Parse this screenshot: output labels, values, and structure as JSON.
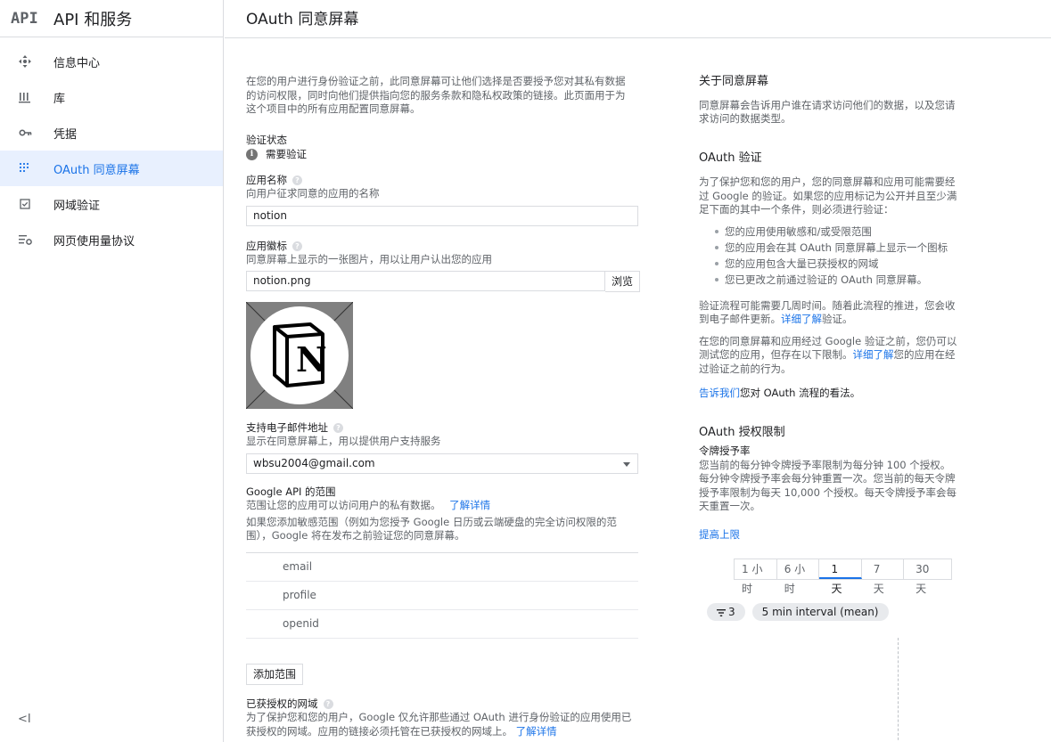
{
  "sidebar": {
    "logo": "API",
    "title": "API 和服务",
    "items": [
      {
        "label": "信息中心"
      },
      {
        "label": "库"
      },
      {
        "label": "凭据"
      },
      {
        "label": "OAuth 同意屏幕"
      },
      {
        "label": "网域验证"
      },
      {
        "label": "网页使用量协议"
      }
    ],
    "collapse": "<I"
  },
  "header": {
    "title": "OAuth 同意屏幕"
  },
  "main": {
    "intro": "在您的用户进行身份验证之前，此同意屏幕可让他们选择是否要授予您对其私有数据的访问权限，同时向他们提供指向您的服务条款和隐私权政策的链接。此页面用于为这个项目中的所有应用配置同意屏幕。",
    "verify_label": "验证状态",
    "verify_status": "需要验证",
    "app_name_label": "应用名称",
    "app_name_sub": "向用户征求同意的应用的名称",
    "app_name_value": "notion",
    "app_logo_label": "应用徽标",
    "app_logo_sub": "同意屏幕上显示的一张图片，用以让用户认出您的应用",
    "app_logo_value": "notion.png",
    "browse": "浏览",
    "logo_letter": "N",
    "support_label": "支持电子邮件地址",
    "support_sub": "显示在同意屏幕上，用以提供用户支持服务",
    "support_value": "wbsu2004@gmail.com",
    "scope_label": "Google API 的范围",
    "scope_sub": "范围让您的应用可以访问用户的私有数据。",
    "scope_learn": "了解详情",
    "scope_note": "如果您添加敏感范围（例如为您授予 Google 日历或云端硬盘的完全访问权限的范围），Google 将在发布之前验证您的同意屏幕。",
    "scopes": [
      "email",
      "profile",
      "openid"
    ],
    "add_scope": "添加范围",
    "domains_label": "已获授权的网域",
    "domains_sub": "为了保护您和您的用户，Google 仅允许那些通过 OAuth 进行身份验证的应用使用已获授权的网域。应用的链接必须托管在已获授权的网域上。",
    "domains_learn": "了解详情"
  },
  "right": {
    "about_title": "关于同意屏幕",
    "about_text": "同意屏幕会告诉用户谁在请求访问他们的数据，以及您请求访问的数据类型。",
    "verify_title": "OAuth 验证",
    "verify_text": "为了保护您和您的用户，您的同意屏幕和应用可能需要经过 Google 的验证。如果您的应用标记为公开并且至少满足下面的其中一个条件，则必须进行验证：",
    "conditions": [
      "您的应用使用敏感和/或受限范围",
      "您的应用会在其 OAuth 同意屏幕上显示一个图标",
      "您的应用包含大量已获授权的网域",
      "您已更改之前通过验证的 OAuth 同意屏幕。"
    ],
    "process_text": "验证流程可能需要几周时间。随着此流程的推进，您会收到电子邮件更新。",
    "process_link": "详细了解",
    "process_tail": "验证。",
    "before_text": "在您的同意屏幕和应用经过 Google 验证之前，您仍可以测试您的应用，但存在以下限制。",
    "before_link": "详细了解",
    "before_tail": "您的应用在经过验证之前的行为。",
    "feedback_link": "告诉我们",
    "feedback_tail": "您对 OAuth 流程的看法。",
    "limits_title": "OAuth 授权限制",
    "rate_title": "令牌授予率",
    "rate_text": "您当前的每分钟令牌授予率限制为每分钟 100 个授权。每分钟令牌授予率会每分钟重置一次。您当前的每天令牌授予率限制为每天 10,000 个授权。每天令牌授予率会每天重置一次。",
    "raise_link": "提高上限",
    "ranges": [
      "1 小时",
      "6 小时",
      "1 天",
      "7 天",
      "30 天"
    ],
    "active_range": "1 天",
    "filter_count": "3",
    "interval": "5 min interval (mean)"
  }
}
